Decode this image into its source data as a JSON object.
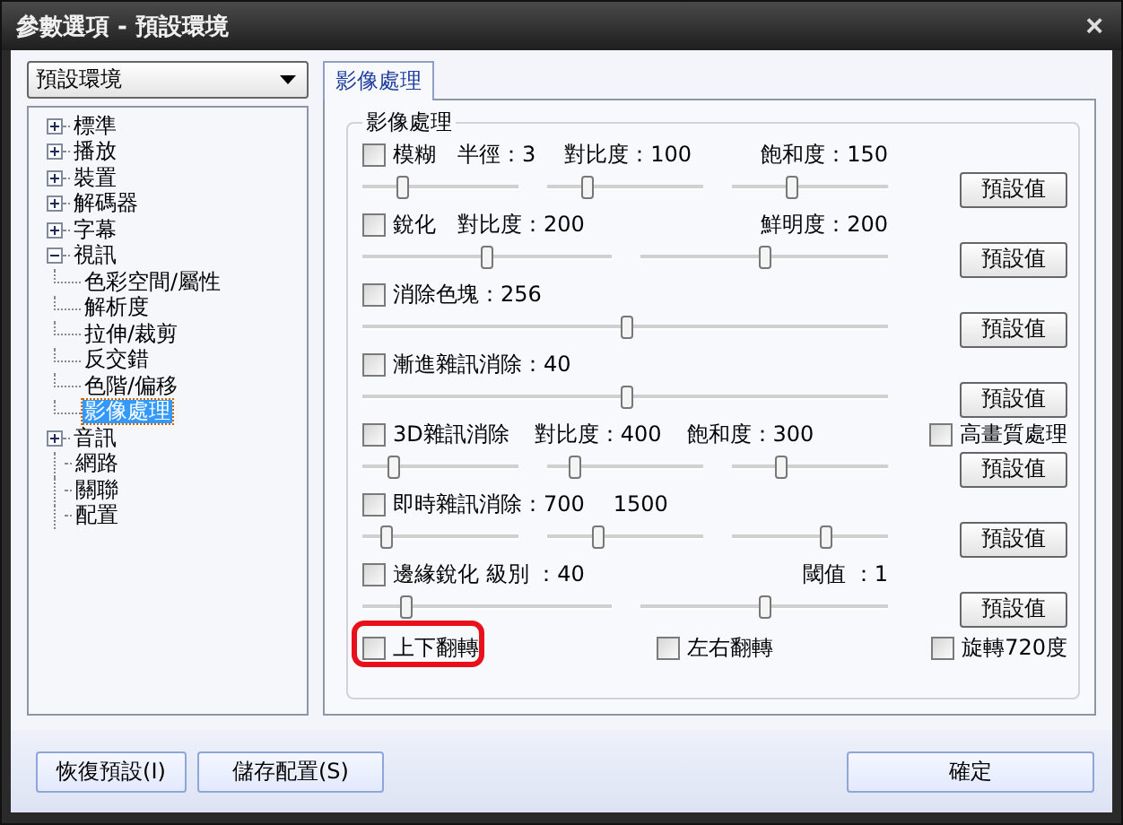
{
  "window": {
    "title": "參數選項 - 預設環境",
    "close": "×"
  },
  "profile": {
    "value": "預設環境"
  },
  "tree": [
    {
      "kind": "folder",
      "label": "標準",
      "expanded": false,
      "selected": false
    },
    {
      "kind": "folder",
      "label": "播放",
      "expanded": false,
      "selected": false
    },
    {
      "kind": "folder",
      "label": "裝置",
      "expanded": false,
      "selected": false
    },
    {
      "kind": "folder",
      "label": "解碼器",
      "expanded": false,
      "selected": false
    },
    {
      "kind": "folder",
      "label": "字幕",
      "expanded": false,
      "selected": false
    },
    {
      "kind": "folder",
      "label": "視訊",
      "expanded": true,
      "selected": false,
      "children": [
        {
          "label": "色彩空間/屬性",
          "selected": false
        },
        {
          "label": "解析度",
          "selected": false
        },
        {
          "label": "拉伸/裁剪",
          "selected": false
        },
        {
          "label": "反交錯",
          "selected": false
        },
        {
          "label": "色階/偏移",
          "selected": false
        },
        {
          "label": "影像處理",
          "selected": true
        }
      ]
    },
    {
      "kind": "folder",
      "label": "音訊",
      "expanded": false,
      "selected": false
    },
    {
      "kind": "leaf",
      "label": "網路",
      "selected": false
    },
    {
      "kind": "leaf",
      "label": "關聯",
      "selected": false
    },
    {
      "kind": "leaf",
      "label": "配置",
      "selected": false
    }
  ],
  "tabs": [
    {
      "label": "影像處理",
      "selected": true
    }
  ],
  "group": {
    "title": "影像處理",
    "rows": [
      {
        "label": "模糊",
        "checked": false,
        "sliders": [
          {
            "level": 0.25,
            "readout": "半徑：3"
          },
          {
            "level": 0.25,
            "readout": "對比度：100"
          },
          {
            "level": 0.38,
            "readout": "飽和度：150"
          }
        ],
        "button": "預設值"
      },
      {
        "label": "銳化",
        "checked": false,
        "sliders": [
          {
            "level": 0.5,
            "readout": "對比度：200"
          },
          {
            "level": 0.5,
            "readout": "鮮明度：200"
          }
        ],
        "button": "預設值"
      },
      {
        "label": "消除色塊：256",
        "checked": false,
        "sliders": [
          {
            "level": 0.5
          }
        ],
        "button": "預設值"
      },
      {
        "label": "漸進雜訊消除：40",
        "checked": false,
        "sliders": [
          {
            "level": 0.5
          }
        ],
        "button": "預設值"
      },
      {
        "label": "3D雜訊消除",
        "checked": false,
        "readouts": [
          "對比度：400",
          "飽和度：300"
        ],
        "sliders": [
          {
            "level": 0.2
          },
          {
            "level": 0.17
          },
          {
            "level": 0.31
          }
        ],
        "button": "預設值",
        "extra": {
          "label": "高畫質處理",
          "checked": false
        }
      },
      {
        "label": "即時雜訊消除：700",
        "checked": false,
        "sliders": [
          {
            "level": 0.15
          },
          {
            "level": 0.32,
            "readout": "1500"
          },
          {
            "level": 0.6
          }
        ],
        "button": "預設值"
      },
      {
        "label": "邊緣銳化 級別 ：40",
        "checked": false,
        "sliders": [
          {
            "level": 0.17
          },
          {
            "level": 0.5,
            "readout": "閾值 ：1"
          }
        ],
        "button": "預設值"
      }
    ],
    "flips": [
      {
        "label": "上下翻轉",
        "checked": false,
        "highlighted": true
      },
      {
        "label": "左右翻轉",
        "checked": false
      },
      {
        "label": "旋轉720度",
        "checked": false
      }
    ]
  },
  "footer": {
    "left": [
      "恢復預設(I)",
      "儲存配置(S)"
    ],
    "right": [
      "確定"
    ]
  }
}
